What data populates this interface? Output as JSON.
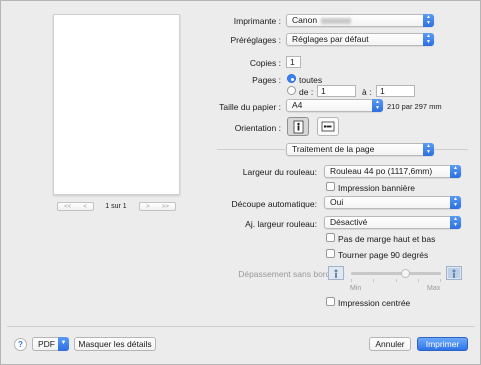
{
  "preview": {
    "page_indicator": "1 sur 1",
    "nav_first": "<<",
    "nav_prev": "<",
    "nav_next": ">",
    "nav_last": ">>"
  },
  "printer": {
    "label": "Imprimante :",
    "value": "Canon"
  },
  "presets": {
    "label": "Préréglages :",
    "value": "Réglages par défaut"
  },
  "copies": {
    "label": "Copies :",
    "value": "1"
  },
  "pages": {
    "label": "Pages :",
    "all_label": "toutes",
    "from_label": "de :",
    "from_value": "1",
    "to_label": "à :",
    "to_value": "1",
    "selected": "all"
  },
  "paper_size": {
    "label": "Taille du papier :",
    "value": "A4",
    "dimensions": "210 par 297 mm"
  },
  "orientation": {
    "label": "Orientation :",
    "selected": "portrait"
  },
  "section": {
    "value": "Traitement de la page"
  },
  "roll_width": {
    "label": "Largeur du rouleau:",
    "value": "Rouleau 44 po (1117,6mm)",
    "banner_label": "Impression bannière",
    "banner_checked": false
  },
  "auto_cut": {
    "label": "Découpe automatique:",
    "value": "Oui"
  },
  "adjust_roll": {
    "label": "Aj. largeur rouleau:",
    "value": "Désactivé",
    "no_margin_label": "Pas de marge haut et bas",
    "no_margin_checked": false,
    "rotate_label": "Tourner page 90 degrés",
    "rotate_checked": false
  },
  "borderless_overflow": {
    "label": "Dépassement sans bordure:",
    "min_label": "Min",
    "max_label": "Max",
    "level_fraction": 0.6,
    "enabled": false
  },
  "centered": {
    "label": "Impression centrée",
    "checked": false
  },
  "footer": {
    "help_label": "?",
    "pdf_label": "PDF",
    "hide_details_label": "Masquer les détails",
    "cancel_label": "Annuler",
    "print_label": "Imprimer"
  },
  "colors": {
    "accent": "#2f74e8",
    "window_bg": "#ececec"
  }
}
